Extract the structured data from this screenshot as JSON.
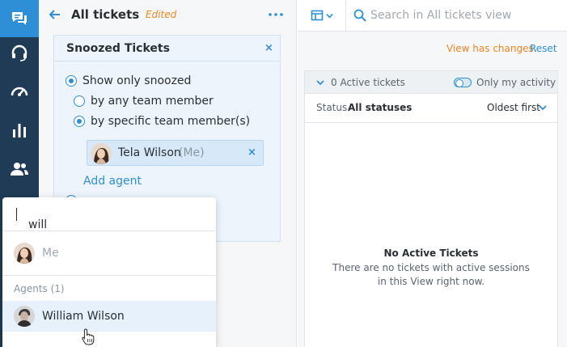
{
  "nav": {
    "items": [
      {
        "name": "tickets",
        "icon": "chat-bubbles-icon",
        "active": true
      },
      {
        "name": "support",
        "icon": "headset-icon",
        "active": false
      },
      {
        "name": "dashboard",
        "icon": "speedometer-icon",
        "active": false
      },
      {
        "name": "reports",
        "icon": "bar-chart-icon",
        "active": false
      },
      {
        "name": "customers",
        "icon": "users-icon",
        "active": false
      }
    ]
  },
  "header": {
    "title": "All tickets",
    "edited": "Edited"
  },
  "filter": {
    "title": "Snoozed Tickets",
    "close": "×",
    "options": {
      "show_only_snoozed": "Show only snoozed",
      "any_member": "by any team member",
      "specific_member": "by specific team member(s)"
    },
    "selected_agent": {
      "name": "Tela Wilson",
      "suffix": "(Me)",
      "remove": "×"
    },
    "add_agent": "Add agent"
  },
  "dropdown": {
    "query": "will",
    "me_label": "Me",
    "group_label": "Agents (1)",
    "agents": [
      {
        "name": "William Wilson"
      }
    ]
  },
  "search": {
    "placeholder": "Search in All tickets view"
  },
  "view": {
    "changes_text": "View has changes.",
    "reset": "Reset"
  },
  "tickets": {
    "active_count": "0 Active tickets",
    "only_my_activity": "Only my activity",
    "status_label": "Status",
    "status_value": "All statuses",
    "sort": "Oldest first",
    "empty_title": "No Active Tickets",
    "empty_line1": "There are no tickets with active sessions",
    "empty_line2": "in this View right now."
  },
  "colors": {
    "accent": "#2e8fd6",
    "nav_bg": "#1f3b55",
    "warning": "#f0851f"
  }
}
